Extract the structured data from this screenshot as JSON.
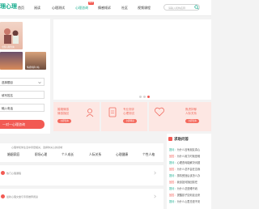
{
  "header": {
    "logo": "理心理",
    "nav": [
      "首页",
      "阅读",
      "心理测试",
      "心理咨询",
      "情感倾诉",
      "社区",
      "视频课程"
    ],
    "hot_badge": "HOT",
    "search_placeholder": "请输入机构名称"
  },
  "left": {
    "thumb1_caption": "全国心理咨询",
    "thumb2_caption": "情感倾诉小站",
    "form": {
      "field1": "选择题目",
      "field2": "填写姓名",
      "field3": "输入电话",
      "submit": "一对一心理咨询"
    }
  },
  "services": [
    {
      "title": "婚姻情感\n情感挽回",
      "button": "立即咨询"
    },
    {
      "title": "专业测评\n心理测试",
      "button": "立即测试"
    },
    {
      "title": "焦虑抑郁\n人际关系",
      "button": "立即咨询"
    }
  ],
  "qa": {
    "title": "求助问答",
    "rows": [
      {
        "role": "提问：",
        "text": "为什么没有朋友真心"
      },
      {
        "role": "回答：",
        "text": "为什么用力时就是难"
      },
      {
        "role": "提问：",
        "text": "心理咨询能解决问题"
      },
      {
        "role": "回答：",
        "text": "为什么总不会在意我"
      },
      {
        "role": "提问：",
        "text": "感情受挫后该怎么办"
      },
      {
        "role": "回答：",
        "text": "我该如何挽回前任"
      },
      {
        "role": "提问：",
        "text": "为什么总是睡不着"
      },
      {
        "role": "回答：",
        "text": "提醒孩子如何走出来"
      },
      {
        "role": "提问：",
        "text": "为什么心里总是不安"
      }
    ]
  },
  "categories": {
    "link_text": "心理学和你生活中紧密相关，选择你关心的领域",
    "items": [
      "婚姻家庭",
      "职场心理",
      "个人成长",
      "人际关系",
      "心理健康",
      "个性人格"
    ]
  },
  "blocks": [
    {
      "text": "热门心理课程"
    },
    {
      "text": "最新心理文章与专家推荐阅读"
    }
  ]
}
